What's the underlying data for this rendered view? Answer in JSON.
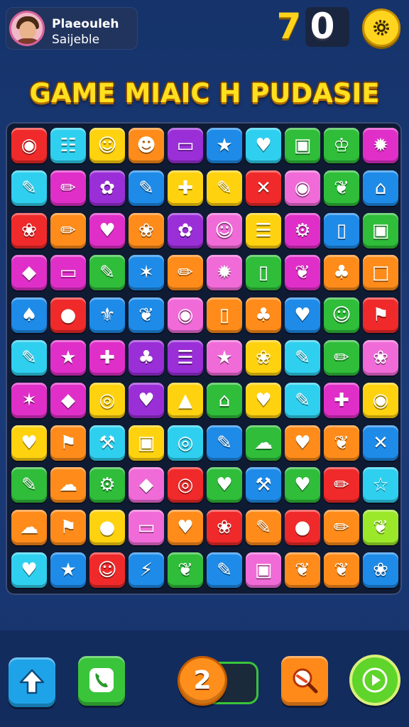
{
  "player": {
    "name": "Plaeouleh",
    "subtitle": "Saijeble"
  },
  "score": {
    "digit_a": "7",
    "digit_b": "0"
  },
  "title": "GAME MIAIC H PUDASIE",
  "hint_count": "2",
  "colors": {
    "yellow": "#ffd20f",
    "orange": "#ff8c1a",
    "red": "#f02a2a",
    "green": "#2fbd3a",
    "blue": "#1e8be8",
    "cyan": "#2fd0ef",
    "purple": "#9a2fd8",
    "magenta": "#e02fc8",
    "pink": "#f06bd8",
    "lime": "#9be82a"
  },
  "board": [
    [
      [
        "red",
        "◉"
      ],
      [
        "cyan",
        "☷"
      ],
      [
        "yellow",
        "☺"
      ],
      [
        "orange",
        "☻"
      ],
      [
        "purple",
        "▭"
      ],
      [
        "blue",
        "★"
      ],
      [
        "cyan",
        "♥"
      ],
      [
        "green",
        "▣"
      ],
      [
        "green",
        "♔"
      ],
      [
        "magenta",
        "✹"
      ]
    ],
    [
      [
        "cyan",
        "✎"
      ],
      [
        "magenta",
        "✏"
      ],
      [
        "purple",
        "✿"
      ],
      [
        "blue",
        "✎"
      ],
      [
        "yellow",
        "✚"
      ],
      [
        "yellow",
        "✎"
      ],
      [
        "red",
        "✕"
      ],
      [
        "pink",
        "◉"
      ],
      [
        "green",
        "❦"
      ],
      [
        "blue",
        "⌂"
      ]
    ],
    [
      [
        "red",
        "❀"
      ],
      [
        "orange",
        "✏"
      ],
      [
        "magenta",
        "♥"
      ],
      [
        "orange",
        "❀"
      ],
      [
        "purple",
        "✿"
      ],
      [
        "pink",
        "☺"
      ],
      [
        "yellow",
        "☰"
      ],
      [
        "magenta",
        "⚙"
      ],
      [
        "blue",
        "▯"
      ],
      [
        "green",
        "▣"
      ]
    ],
    [
      [
        "magenta",
        "◆"
      ],
      [
        "magenta",
        "▭"
      ],
      [
        "green",
        "✎"
      ],
      [
        "blue",
        "✶"
      ],
      [
        "orange",
        "✏"
      ],
      [
        "pink",
        "✹"
      ],
      [
        "green",
        "▯"
      ],
      [
        "magenta",
        "❦"
      ],
      [
        "orange",
        "♣"
      ],
      [
        "orange",
        "□"
      ]
    ],
    [
      [
        "blue",
        "♠"
      ],
      [
        "red",
        "●"
      ],
      [
        "blue",
        "⚜"
      ],
      [
        "blue",
        "❦"
      ],
      [
        "pink",
        "◉"
      ],
      [
        "orange",
        "▯"
      ],
      [
        "orange",
        "♣"
      ],
      [
        "blue",
        "♥"
      ],
      [
        "green",
        "☺"
      ],
      [
        "red",
        "⚑"
      ]
    ],
    [
      [
        "cyan",
        "✎"
      ],
      [
        "magenta",
        "★"
      ],
      [
        "magenta",
        "✚"
      ],
      [
        "purple",
        "♣"
      ],
      [
        "purple",
        "☰"
      ],
      [
        "pink",
        "★"
      ],
      [
        "yellow",
        "❀"
      ],
      [
        "cyan",
        "✎"
      ],
      [
        "green",
        "✏"
      ],
      [
        "pink",
        "❀"
      ]
    ],
    [
      [
        "magenta",
        "✶"
      ],
      [
        "magenta",
        "◆"
      ],
      [
        "yellow",
        "◎"
      ],
      [
        "purple",
        "♥"
      ],
      [
        "yellow",
        "▲"
      ],
      [
        "green",
        "⌂"
      ],
      [
        "yellow",
        "♥"
      ],
      [
        "cyan",
        "✎"
      ],
      [
        "magenta",
        "✚"
      ],
      [
        "yellow",
        "◉"
      ]
    ],
    [
      [
        "yellow",
        "♥"
      ],
      [
        "orange",
        "⚑"
      ],
      [
        "cyan",
        "⚒"
      ],
      [
        "yellow",
        "▣"
      ],
      [
        "cyan",
        "◎"
      ],
      [
        "blue",
        "✎"
      ],
      [
        "green",
        "☁"
      ],
      [
        "orange",
        "♥"
      ],
      [
        "orange",
        "❦"
      ],
      [
        "blue",
        "✕"
      ]
    ],
    [
      [
        "green",
        "✎"
      ],
      [
        "orange",
        "☁"
      ],
      [
        "green",
        "⚙"
      ],
      [
        "pink",
        "◆"
      ],
      [
        "red",
        "◎"
      ],
      [
        "green",
        "♥"
      ],
      [
        "blue",
        "⚒"
      ],
      [
        "green",
        "♥"
      ],
      [
        "red",
        "✏"
      ],
      [
        "cyan",
        "☆"
      ]
    ],
    [
      [
        "orange",
        "☁"
      ],
      [
        "orange",
        "⚑"
      ],
      [
        "yellow",
        "●"
      ],
      [
        "pink",
        "▭"
      ],
      [
        "orange",
        "♥"
      ],
      [
        "red",
        "❀"
      ],
      [
        "orange",
        "✎"
      ],
      [
        "red",
        "●"
      ],
      [
        "orange",
        "✏"
      ],
      [
        "lime",
        "❦"
      ]
    ],
    [
      [
        "cyan",
        "♥"
      ],
      [
        "blue",
        "★"
      ],
      [
        "red",
        "☺"
      ],
      [
        "blue",
        "⚡"
      ],
      [
        "green",
        "❦"
      ],
      [
        "blue",
        "✎"
      ],
      [
        "pink",
        "▣"
      ],
      [
        "orange",
        "❦"
      ],
      [
        "orange",
        "❦"
      ],
      [
        "blue",
        "❀"
      ]
    ]
  ]
}
